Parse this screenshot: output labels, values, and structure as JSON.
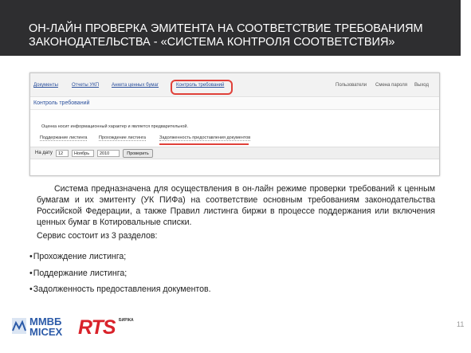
{
  "header": {
    "title": "ОН-ЛАЙН ПРОВЕРКА ЭМИТЕНТА НА СООТВЕТСТВИЕ ТРЕБОВАНИЯМ ЗАКОНОДАТЕЛЬСТВА - «СИСТЕМА КОНТРОЛЯ СООТВЕТСТВИЯ»",
    "color": "#2e2e30"
  },
  "screenshot": {
    "nav": [
      "Документы",
      "Отчеты УКП",
      "Анкета ценных бумаг",
      "Контроль требований"
    ],
    "nav_right": [
      "Пользователи",
      "Смена пароля",
      "Выход"
    ],
    "highlight_color": "#e0413a",
    "breadcrumb": "Контроль требований",
    "note": "Оценка носит информационный характер и является предварительной.",
    "tabs": [
      "Поддержание листинга",
      "Прохождение листинга",
      "Задолженность предоставления документов"
    ],
    "filter_label": "На дату",
    "day": "12",
    "month": "Ноябрь",
    "year": "2010",
    "button": "Проверить"
  },
  "text": {
    "paragraph": "Система предназначена для осуществления в он-лайн режиме проверки требований к ценным бумагам и их эмитенту (УК ПИФа) на соответствие основным требованиям законодательства Российской Федерации, а также Правил листинга биржи в процессе поддержания или включения ценных бумаг в Котировальные списки.",
    "sections_intro": "Сервис состоит из 3 разделов:",
    "sections": [
      "Прохождение листинга;",
      "Поддержание листинга;",
      "Задолженность предоставления документов."
    ]
  },
  "footer": {
    "logo1_line1": "ММВБ",
    "logo1_line2": "MICEX",
    "logo2": "RTS",
    "logo2_sub": "БИРЖА",
    "page_number": "11",
    "brand_blue": "#2b5aa8",
    "brand_red": "#d9222a"
  }
}
